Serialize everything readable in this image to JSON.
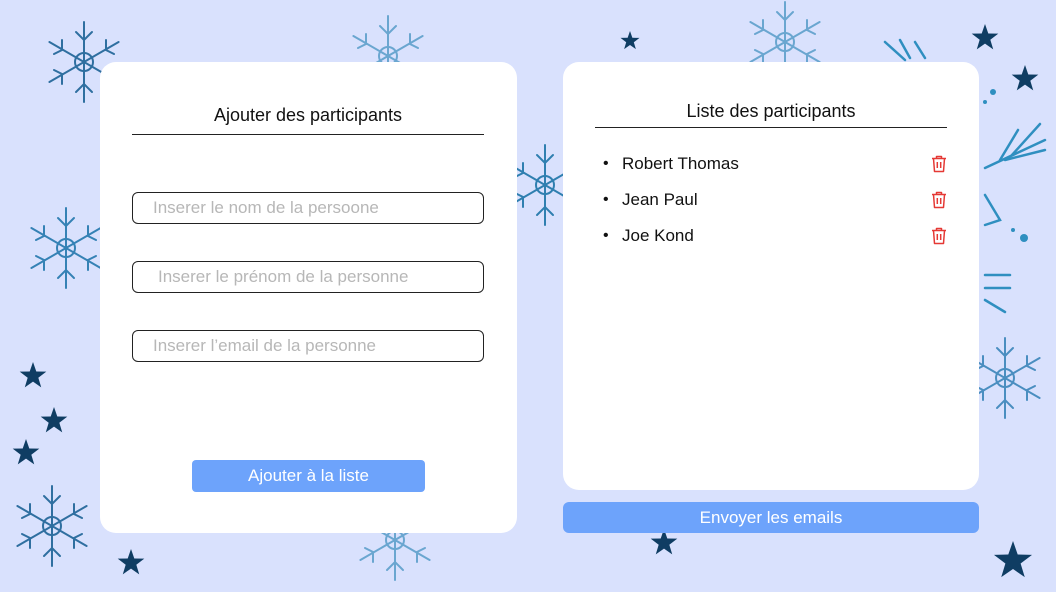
{
  "add_card": {
    "title": "Ajouter des participants",
    "fields": {
      "nom_placeholder": "Inserer le nom de la persoone",
      "prenom_placeholder": "Inserer le prénom de la personne",
      "email_placeholder": "Inserer l’email de la personne"
    },
    "add_button": "Ajouter à la liste"
  },
  "list_card": {
    "title": "Liste des participants",
    "participants": [
      {
        "name": "Robert Thomas",
        "icon": "trash-icon"
      },
      {
        "name": "Jean Paul",
        "icon": "trash-icon"
      },
      {
        "name": "Joe Kond",
        "icon": "trash-icon"
      }
    ]
  },
  "send_button": "Envoyer les emails",
  "colors": {
    "background": "#d9e1fd",
    "button": "#6da3fb",
    "delete_icon": "#e53935",
    "star": "#0f3d63",
    "snowflake": "#2f7fb0"
  }
}
